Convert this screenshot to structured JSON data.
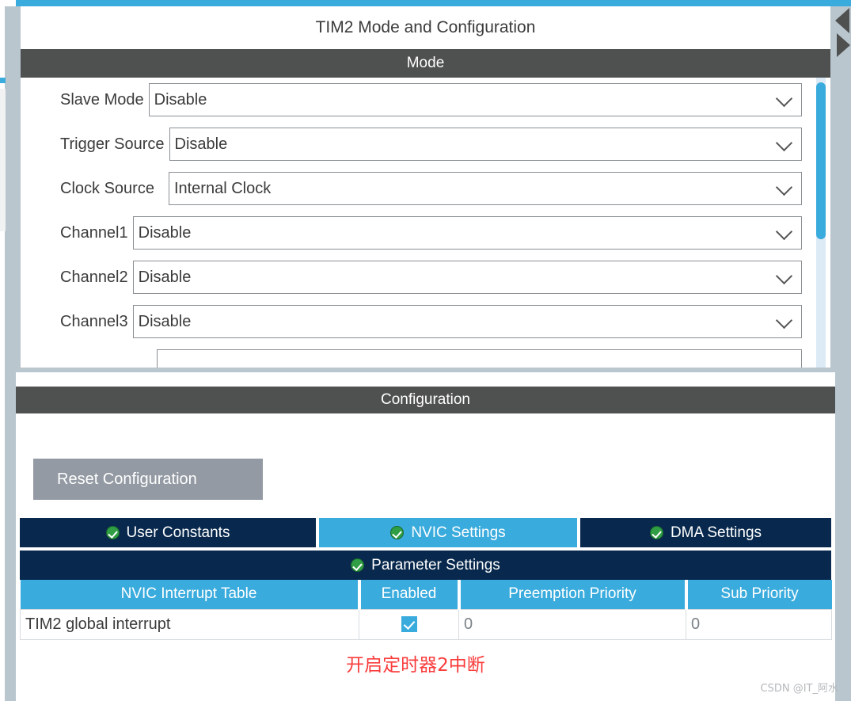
{
  "window": {
    "title": "TIM2 Mode and Configuration",
    "accent_color": "#3aabdd",
    "header_bg": "#4f5050",
    "tab_bg": "#08294d"
  },
  "mode_section": {
    "header": "Mode",
    "fields": [
      {
        "label": "Slave Mode",
        "value": "Disable",
        "icon": "chevron-down-icon"
      },
      {
        "label": "Trigger Source",
        "value": "Disable",
        "icon": "chevron-down-icon"
      },
      {
        "label": "Clock Source",
        "value": "Internal Clock",
        "icon": "chevron-down-icon"
      },
      {
        "label": "Channel1",
        "value": "Disable",
        "icon": "chevron-down-icon"
      },
      {
        "label": "Channel2",
        "value": "Disable",
        "icon": "chevron-down-icon"
      },
      {
        "label": "Channel3",
        "value": "Disable",
        "icon": "chevron-down-icon"
      },
      {
        "label": "",
        "value": "",
        "icon": "chevron-down-icon"
      }
    ]
  },
  "configuration": {
    "header": "Configuration",
    "reset_button": "Reset Configuration",
    "tabs": [
      {
        "label": "User Constants",
        "active": false,
        "icon": "green-check-icon"
      },
      {
        "label": "NVIC Settings",
        "active": true,
        "icon": "green-check-icon"
      },
      {
        "label": "DMA Settings",
        "active": false,
        "icon": "green-check-icon"
      },
      {
        "label": "Parameter Settings",
        "active": false,
        "icon": "green-check-icon"
      }
    ],
    "table": {
      "columns": [
        "NVIC Interrupt Table",
        "Enabled",
        "Preemption Priority",
        "Sub Priority"
      ],
      "rows": [
        {
          "name": "TIM2 global interrupt",
          "enabled": true,
          "preemption_priority": "0",
          "sub_priority": "0"
        }
      ]
    }
  },
  "annotation": "开启定时器2中断",
  "watermark": "CSDN @IT_阿水"
}
